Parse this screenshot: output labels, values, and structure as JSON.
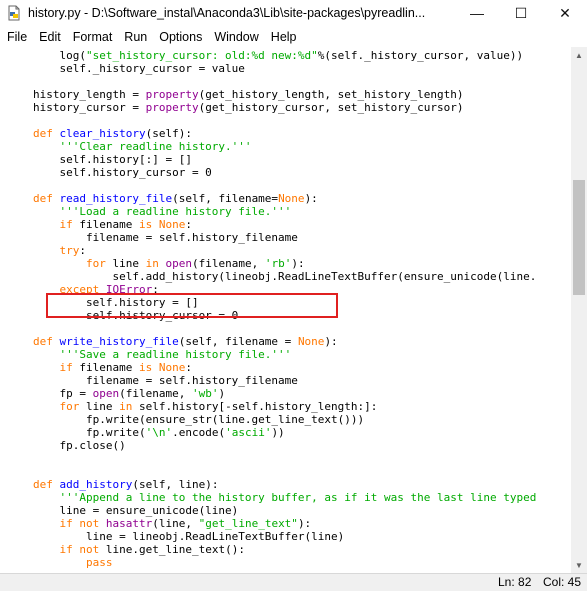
{
  "window": {
    "title": "history.py - D:\\Software_instal\\Anaconda3\\Lib\\site-packages\\pyreadlin...",
    "minimize_glyph": "—",
    "maximize_glyph": "☐",
    "close_glyph": "✕",
    "app_icon": "python-file-icon"
  },
  "menu": [
    "File",
    "Edit",
    "Format",
    "Run",
    "Options",
    "Window",
    "Help"
  ],
  "code_lines": [
    [
      [
        "t",
        "    log("
      ],
      [
        "s",
        "\"set_history_cursor: old:%d new:%d\""
      ],
      [
        "t",
        "%(self._history_cursor, value))"
      ]
    ],
    [
      [
        "t",
        "    self._history_cursor = value"
      ]
    ],
    [
      [
        "t",
        ""
      ]
    ],
    [
      [
        "t",
        "history_length = "
      ],
      [
        "b",
        "property"
      ],
      [
        "t",
        "(get_history_length, set_history_length)"
      ]
    ],
    [
      [
        "t",
        "history_cursor = "
      ],
      [
        "b",
        "property"
      ],
      [
        "t",
        "(get_history_cursor, set_history_cursor)"
      ]
    ],
    [
      [
        "t",
        ""
      ]
    ],
    [
      [
        "k",
        "def "
      ],
      [
        "d",
        "clear_history"
      ],
      [
        "t",
        "(self):"
      ]
    ],
    [
      [
        "s",
        "    '''Clear readline history.'''"
      ]
    ],
    [
      [
        "t",
        "    self.history[:] = []"
      ]
    ],
    [
      [
        "t",
        "    self.history_cursor = 0"
      ]
    ],
    [
      [
        "t",
        ""
      ]
    ],
    [
      [
        "k",
        "def "
      ],
      [
        "d",
        "read_history_file"
      ],
      [
        "t",
        "(self, filename="
      ],
      [
        "k",
        "None"
      ],
      [
        "t",
        "):"
      ]
    ],
    [
      [
        "s",
        "    '''Load a readline history file.'''"
      ]
    ],
    [
      [
        "t",
        "    "
      ],
      [
        "k",
        "if"
      ],
      [
        "t",
        " filename "
      ],
      [
        "k",
        "is"
      ],
      [
        "t",
        " "
      ],
      [
        "k",
        "None"
      ],
      [
        "t",
        ":"
      ]
    ],
    [
      [
        "t",
        "        filename = self.history_filename"
      ]
    ],
    [
      [
        "t",
        "    "
      ],
      [
        "k",
        "try"
      ],
      [
        "t",
        ":"
      ]
    ],
    [
      [
        "t",
        "        "
      ],
      [
        "k",
        "for"
      ],
      [
        "t",
        " line "
      ],
      [
        "k",
        "in"
      ],
      [
        "t",
        " "
      ],
      [
        "b",
        "open"
      ],
      [
        "t",
        "(filename, "
      ],
      [
        "s",
        "'rb'"
      ],
      [
        "t",
        "):"
      ]
    ],
    [
      [
        "t",
        "            self.add_history(lineobj.ReadLineTextBuffer(ensure_unicode(line."
      ]
    ],
    [
      [
        "t",
        "    "
      ],
      [
        "k",
        "except"
      ],
      [
        "t",
        " "
      ],
      [
        "b",
        "IOError"
      ],
      [
        "t",
        ":"
      ]
    ],
    [
      [
        "t",
        "        self.history = []"
      ]
    ],
    [
      [
        "t",
        "        self.history_cursor = 0"
      ]
    ],
    [
      [
        "t",
        ""
      ]
    ],
    [
      [
        "k",
        "def "
      ],
      [
        "d",
        "write_history_file"
      ],
      [
        "t",
        "(self, filename = "
      ],
      [
        "k",
        "None"
      ],
      [
        "t",
        "):"
      ]
    ],
    [
      [
        "s",
        "    '''Save a readline history file.'''"
      ]
    ],
    [
      [
        "t",
        "    "
      ],
      [
        "k",
        "if"
      ],
      [
        "t",
        " filename "
      ],
      [
        "k",
        "is"
      ],
      [
        "t",
        " "
      ],
      [
        "k",
        "None"
      ],
      [
        "t",
        ":"
      ]
    ],
    [
      [
        "t",
        "        filename = self.history_filename"
      ]
    ],
    [
      [
        "t",
        "    fp = "
      ],
      [
        "b",
        "open"
      ],
      [
        "t",
        "(filename, "
      ],
      [
        "s",
        "'wb'"
      ],
      [
        "t",
        ")"
      ]
    ],
    [
      [
        "t",
        "    "
      ],
      [
        "k",
        "for"
      ],
      [
        "t",
        " line "
      ],
      [
        "k",
        "in"
      ],
      [
        "t",
        " self.history[-self.history_length:]:"
      ]
    ],
    [
      [
        "t",
        "        fp.write(ensure_str(line.get_line_text()))"
      ]
    ],
    [
      [
        "t",
        "        fp.write("
      ],
      [
        "s",
        "'\\n'"
      ],
      [
        "t",
        ".encode("
      ],
      [
        "s",
        "'ascii'"
      ],
      [
        "t",
        "))"
      ]
    ],
    [
      [
        "t",
        "    fp.close()"
      ]
    ],
    [
      [
        "t",
        ""
      ]
    ],
    [
      [
        "t",
        ""
      ]
    ],
    [
      [
        "k",
        "def "
      ],
      [
        "d",
        "add_history"
      ],
      [
        "t",
        "(self, line):"
      ]
    ],
    [
      [
        "s",
        "    '''Append a line to the history buffer, as if it was the last line typed"
      ]
    ],
    [
      [
        "t",
        "    line = ensure_unicode(line)"
      ]
    ],
    [
      [
        "t",
        "    "
      ],
      [
        "k",
        "if"
      ],
      [
        "t",
        " "
      ],
      [
        "k",
        "not"
      ],
      [
        "t",
        " "
      ],
      [
        "b",
        "hasattr"
      ],
      [
        "t",
        "(line, "
      ],
      [
        "s",
        "\"get_line_text\""
      ],
      [
        "t",
        "):"
      ]
    ],
    [
      [
        "t",
        "        line = lineobj.ReadLineTextBuffer(line)"
      ]
    ],
    [
      [
        "t",
        "    "
      ],
      [
        "k",
        "if"
      ],
      [
        "t",
        " "
      ],
      [
        "k",
        "not"
      ],
      [
        "t",
        " line.get_line_text():"
      ]
    ],
    [
      [
        "t",
        "        "
      ],
      [
        "k",
        "pass"
      ]
    ]
  ],
  "status": {
    "line": "Ln: 82",
    "col": "Col: 45"
  },
  "colors": {
    "keyword": "#ff7700",
    "builtin": "#900090",
    "string": "#00aa00",
    "definition": "#0000ff",
    "highlight_box": "#e02020"
  }
}
